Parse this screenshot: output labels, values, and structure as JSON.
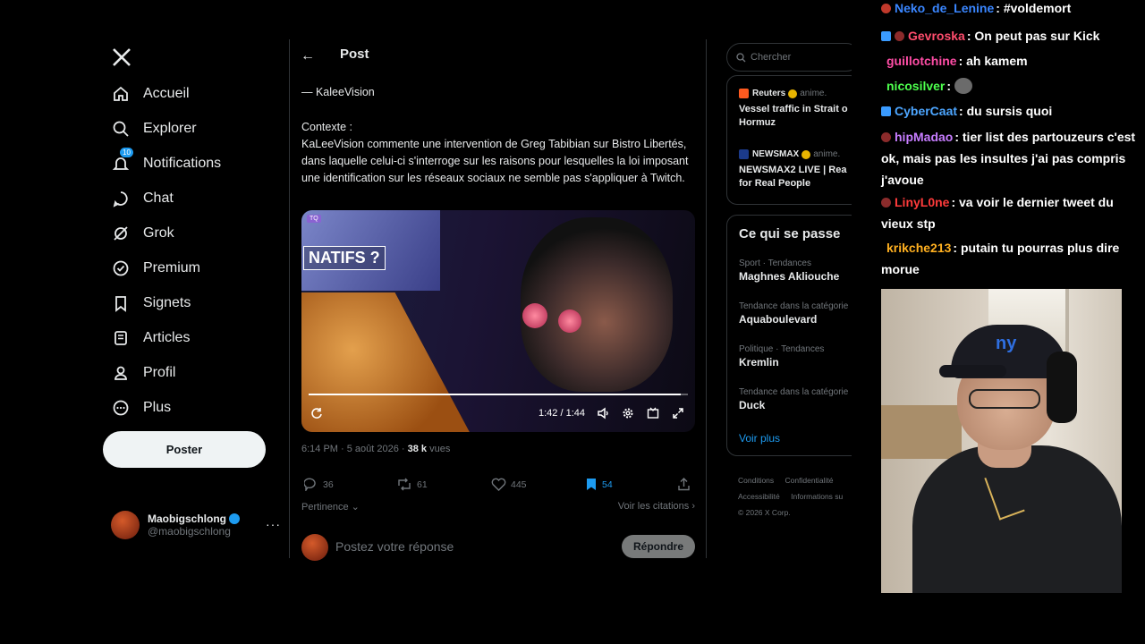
{
  "nav": {
    "items": [
      {
        "label": "Accueil",
        "icon": "home-icon"
      },
      {
        "label": "Explorer",
        "icon": "search-icon"
      },
      {
        "label": "Notifications",
        "icon": "bell-icon",
        "badge": "10"
      },
      {
        "label": "Chat",
        "icon": "chat-icon"
      },
      {
        "label": "Grok",
        "icon": "grok-icon"
      },
      {
        "label": "Premium",
        "icon": "premium-icon"
      },
      {
        "label": "Signets",
        "icon": "bookmark-icon"
      },
      {
        "label": "Articles",
        "icon": "article-icon"
      },
      {
        "label": "Profil",
        "icon": "profile-icon"
      },
      {
        "label": "Plus",
        "icon": "more-circle-icon"
      }
    ],
    "post_button": "Poster",
    "account": {
      "name": "Maobigschlong",
      "handle": "@maobigschlong"
    }
  },
  "post": {
    "header_title": "Post",
    "signature": "— KaleeVision",
    "context_label": "Contexte :",
    "context_text": "KaLeeVision commente une intervention de Greg Tabibian sur Bistro Libertés, dans laquelle celui-ci s'interroge sur les raisons pour lesquelles la loi imposant une identification sur les réseaux sociaux ne semble pas s'appliquer à Twitch.",
    "video": {
      "overlay_text": "NATIFS ?",
      "tag": "TQ",
      "time": "1:42 / 1:44",
      "progress": 0.98
    },
    "time": "6:14 PM · 5 août 2026 ·",
    "views_count": "38 k",
    "views_label": "vues",
    "stats": {
      "replies": "36",
      "reposts": "61",
      "likes": "445",
      "bookmarks": "54"
    },
    "sort_label": "Pertinence",
    "quotes_label": "Voir les citations",
    "reply_placeholder": "Postez votre réponse",
    "reply_button": "Répondre"
  },
  "right": {
    "search_placeholder": "Chercher",
    "news": [
      {
        "source": "Reuters",
        "suffix": "anime.",
        "title_line1": "Vessel traffic in Strait o",
        "title_line2": "Hormuz",
        "color": "#ff5a1f"
      },
      {
        "source": "NEWSMAX",
        "suffix": "anime.",
        "title_line1": "NEWSMAX2 LIVE | Rea",
        "title_line2": "for Real People",
        "color": "#1b3a8a"
      }
    ],
    "trends_title": "Ce qui se passe",
    "trends": [
      {
        "category": "Sport · Tendances",
        "name": "Maghnes Akliouche"
      },
      {
        "category": "Tendance dans la catégorie",
        "name": "Aquaboulevard"
      },
      {
        "category": "Politique · Tendances",
        "name": "Kremlin"
      },
      {
        "category": "Tendance dans la catégorie",
        "name": "Duck"
      }
    ],
    "see_more": "Voir plus",
    "footer_line1": [
      "Conditions",
      "Confidentialité"
    ],
    "footer_line2": [
      "Accessibilité",
      "Informations su"
    ],
    "footer_copy": "© 2026 X Corp."
  },
  "chat": [
    {
      "user": "Neko_de_Lenine",
      "text": ": #voldemort",
      "color": "#3a86ff"
    },
    {
      "user": "Gevroska",
      "text": ": On peut pas sur Kick",
      "color": "#ff4d6d"
    },
    {
      "user": "guillotchine",
      "text": ": ah kamem",
      "color": "#ff4da6"
    },
    {
      "user": "nicosilver",
      "text": ":",
      "color": "#4dff4d"
    },
    {
      "user": "CyberCaat",
      "text": ": du sursis quoi",
      "color": "#4da6ff"
    },
    {
      "user": "hipMadao",
      "text": ": tier list des partouzeurs c'est ok, mais pas les insultes j'ai pas compris j'avoue",
      "color": "#c77dff"
    },
    {
      "user": "LinyL0ne",
      "text": ": va voir le dernier tweet du vieux stp",
      "color": "#ff3b3b"
    },
    {
      "user": "krikche213",
      "text": ": putain tu pourras plus dire morue",
      "color": "#ffb020"
    }
  ]
}
